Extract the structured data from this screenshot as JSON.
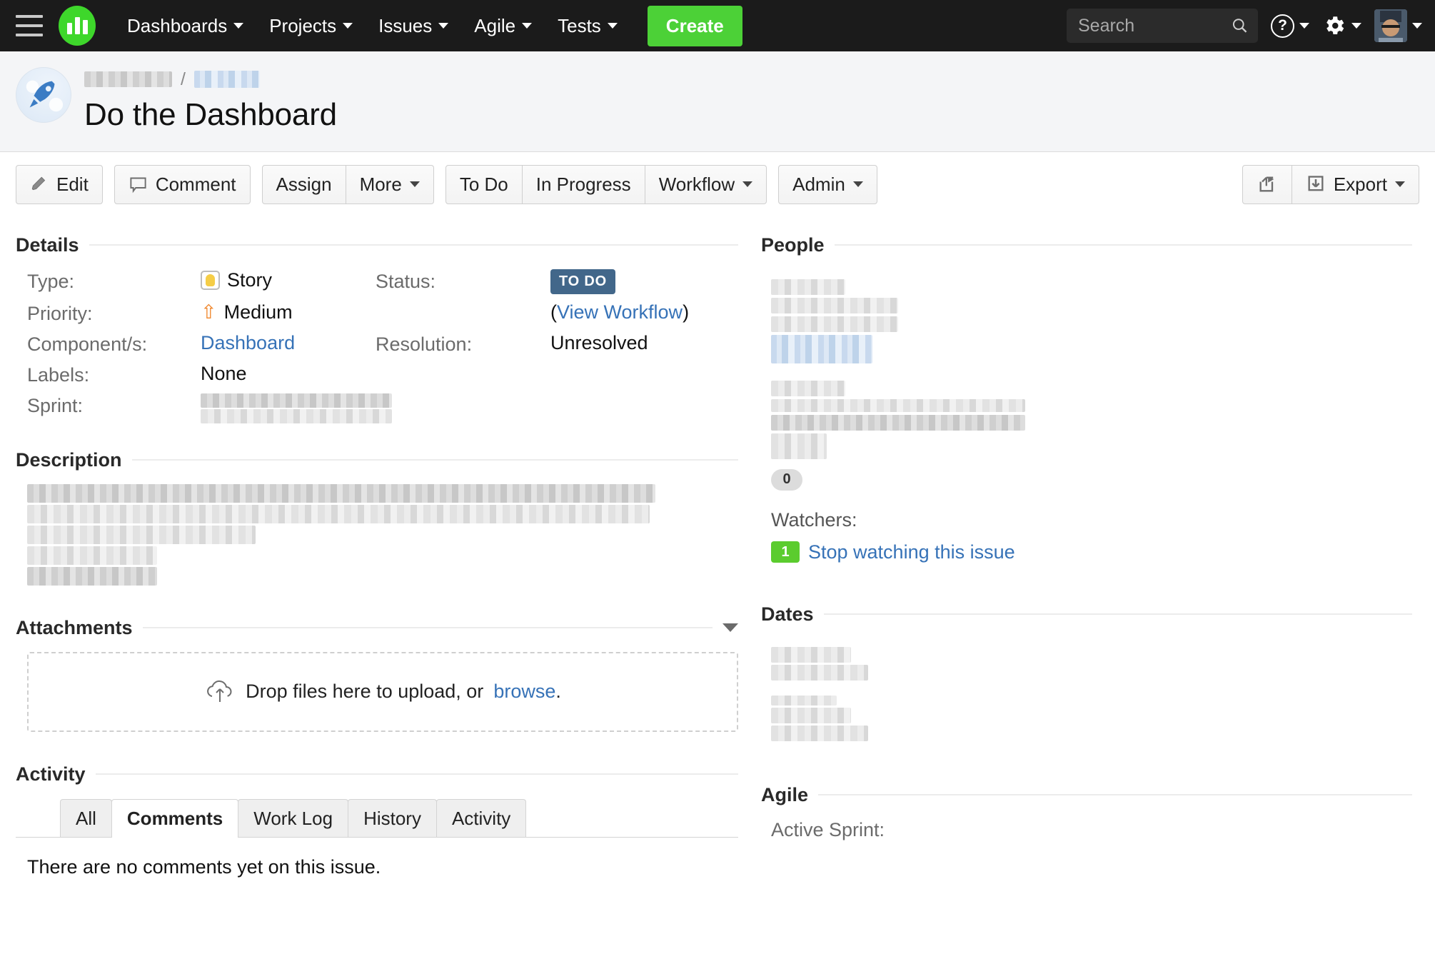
{
  "topnav": {
    "menu_icon": "hamburger-icon",
    "logo_icon": "jira-bars-logo",
    "items": [
      {
        "label": "Dashboards",
        "has_caret": true
      },
      {
        "label": "Projects",
        "has_caret": true
      },
      {
        "label": "Issues",
        "has_caret": true
      },
      {
        "label": "Agile",
        "has_caret": true
      },
      {
        "label": "Tests",
        "has_caret": true
      }
    ],
    "create_label": "Create",
    "search_placeholder": "Search",
    "search_value": "",
    "help_icon": "question-circle-icon",
    "settings_icon": "gear-icon",
    "profile_icon": "user-avatar"
  },
  "issue_header": {
    "project_icon": "rocket-avatar",
    "breadcrumb": {
      "project": "",
      "separator": "/",
      "issue_key": ""
    },
    "title": "Do the Dashboard"
  },
  "toolbar": {
    "edit_label": "Edit",
    "comment_label": "Comment",
    "assign_label": "Assign",
    "more_label": "More",
    "todo_label": "To Do",
    "in_progress_label": "In Progress",
    "workflow_label": "Workflow",
    "admin_label": "Admin",
    "share_icon": "share-icon",
    "export_label": "Export"
  },
  "details": {
    "heading": "Details",
    "fields": {
      "type_label": "Type:",
      "type_value": "Story",
      "priority_label": "Priority:",
      "priority_value": "Medium",
      "components_label": "Component/s:",
      "components_value": "Dashboard",
      "labels_label": "Labels:",
      "labels_value": "None",
      "sprint_label": "Sprint:",
      "sprint_value": "",
      "status_label": "Status:",
      "status_value": "TO DO",
      "status_color": "#42678A",
      "view_workflow_open": "(",
      "view_workflow_link": "View Workflow",
      "view_workflow_close": ")",
      "resolution_label": "Resolution:",
      "resolution_value": "Unresolved"
    }
  },
  "description": {
    "heading": "Description",
    "body": ""
  },
  "attachments": {
    "heading": "Attachments",
    "collapse_icon": "chevron-down-icon",
    "dropzone_icon": "cloud-upload-icon",
    "dropzone_text_before": "Drop files here to upload, or",
    "dropzone_link": "browse",
    "dropzone_text_after": "."
  },
  "activity": {
    "heading": "Activity",
    "tabs": [
      {
        "label": "All",
        "active": false
      },
      {
        "label": "Comments",
        "active": true
      },
      {
        "label": "Work Log",
        "active": false
      },
      {
        "label": "History",
        "active": false
      },
      {
        "label": "Activity",
        "active": false
      }
    ],
    "empty_message": "There are no comments yet on this issue."
  },
  "people": {
    "heading": "People",
    "vote_count": "0",
    "watchers_label": "Watchers:",
    "watcher_count": "1",
    "watch_link": "Stop watching this issue"
  },
  "dates": {
    "heading": "Dates"
  },
  "agile": {
    "heading": "Agile",
    "active_sprint_label": "Active Sprint:"
  },
  "colors": {
    "nav_bg": "#1b1b1b",
    "create_green": "#4CD137",
    "link_blue": "#3672b7",
    "status_blue": "#42678A",
    "watcher_green": "#5bcc2e"
  }
}
